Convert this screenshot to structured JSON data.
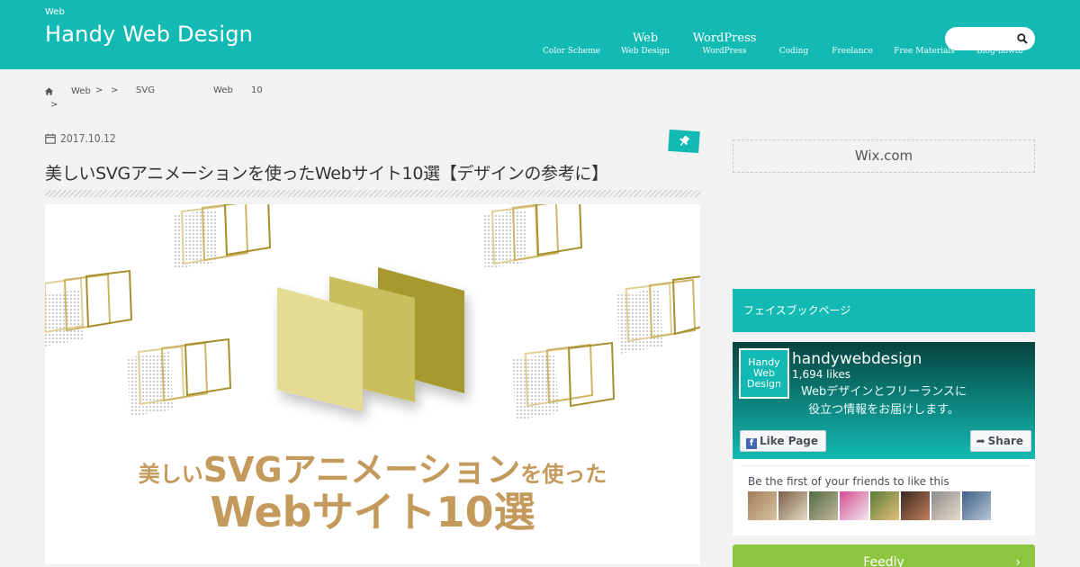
{
  "header": {
    "site_tag": "Web",
    "site_title": "Handy Web Design",
    "nav": [
      {
        "main": "",
        "sub": "Color Scheme"
      },
      {
        "main": "Web",
        "sub": "Web Design"
      },
      {
        "main": "WordPress",
        "sub": "WordPress"
      },
      {
        "main": "",
        "sub": "Coding"
      },
      {
        "main": "",
        "sub": "Freelance"
      },
      {
        "main": "",
        "sub": "Free Materials"
      },
      {
        "main": "",
        "sub": "Blog-howto"
      }
    ],
    "search": {
      "placeholder": ""
    }
  },
  "breadcrumb": {
    "items": [
      "Web",
      "SVG",
      "Web",
      "10"
    ],
    "separator": ">"
  },
  "article": {
    "date": "2017.10.12",
    "title": "美しいSVGアニメーションを使ったWebサイト10選【デザインの参考に】",
    "hero": {
      "line1_small_a": "美しい",
      "line1_big": "SVGアニメーション",
      "line1_small_b": "を使った",
      "line2": "Webサイト10選"
    }
  },
  "sidebar": {
    "ad_label": "Wix.com",
    "section_heading": "フェイスブックページ",
    "facebook": {
      "logo_text": [
        "Handy",
        "Web",
        "Design"
      ],
      "page_name": "handywebdesign",
      "likes": "1,694 likes",
      "tagline_1": "Webデザインとフリーランスに",
      "tagline_2": "役立つ情報をお届けします。",
      "like_button": "Like Page",
      "share_button": "Share",
      "friends_text": "Be the first of your friends to like this"
    },
    "feedly_label": "Feedly"
  },
  "colors": {
    "accent": "#13bab3",
    "feedly": "#8cc63f",
    "hero_text": "#c49a5c",
    "card_light": "#e5dc94",
    "card_mid": "#c9bf5d",
    "card_dark": "#a6982f"
  }
}
